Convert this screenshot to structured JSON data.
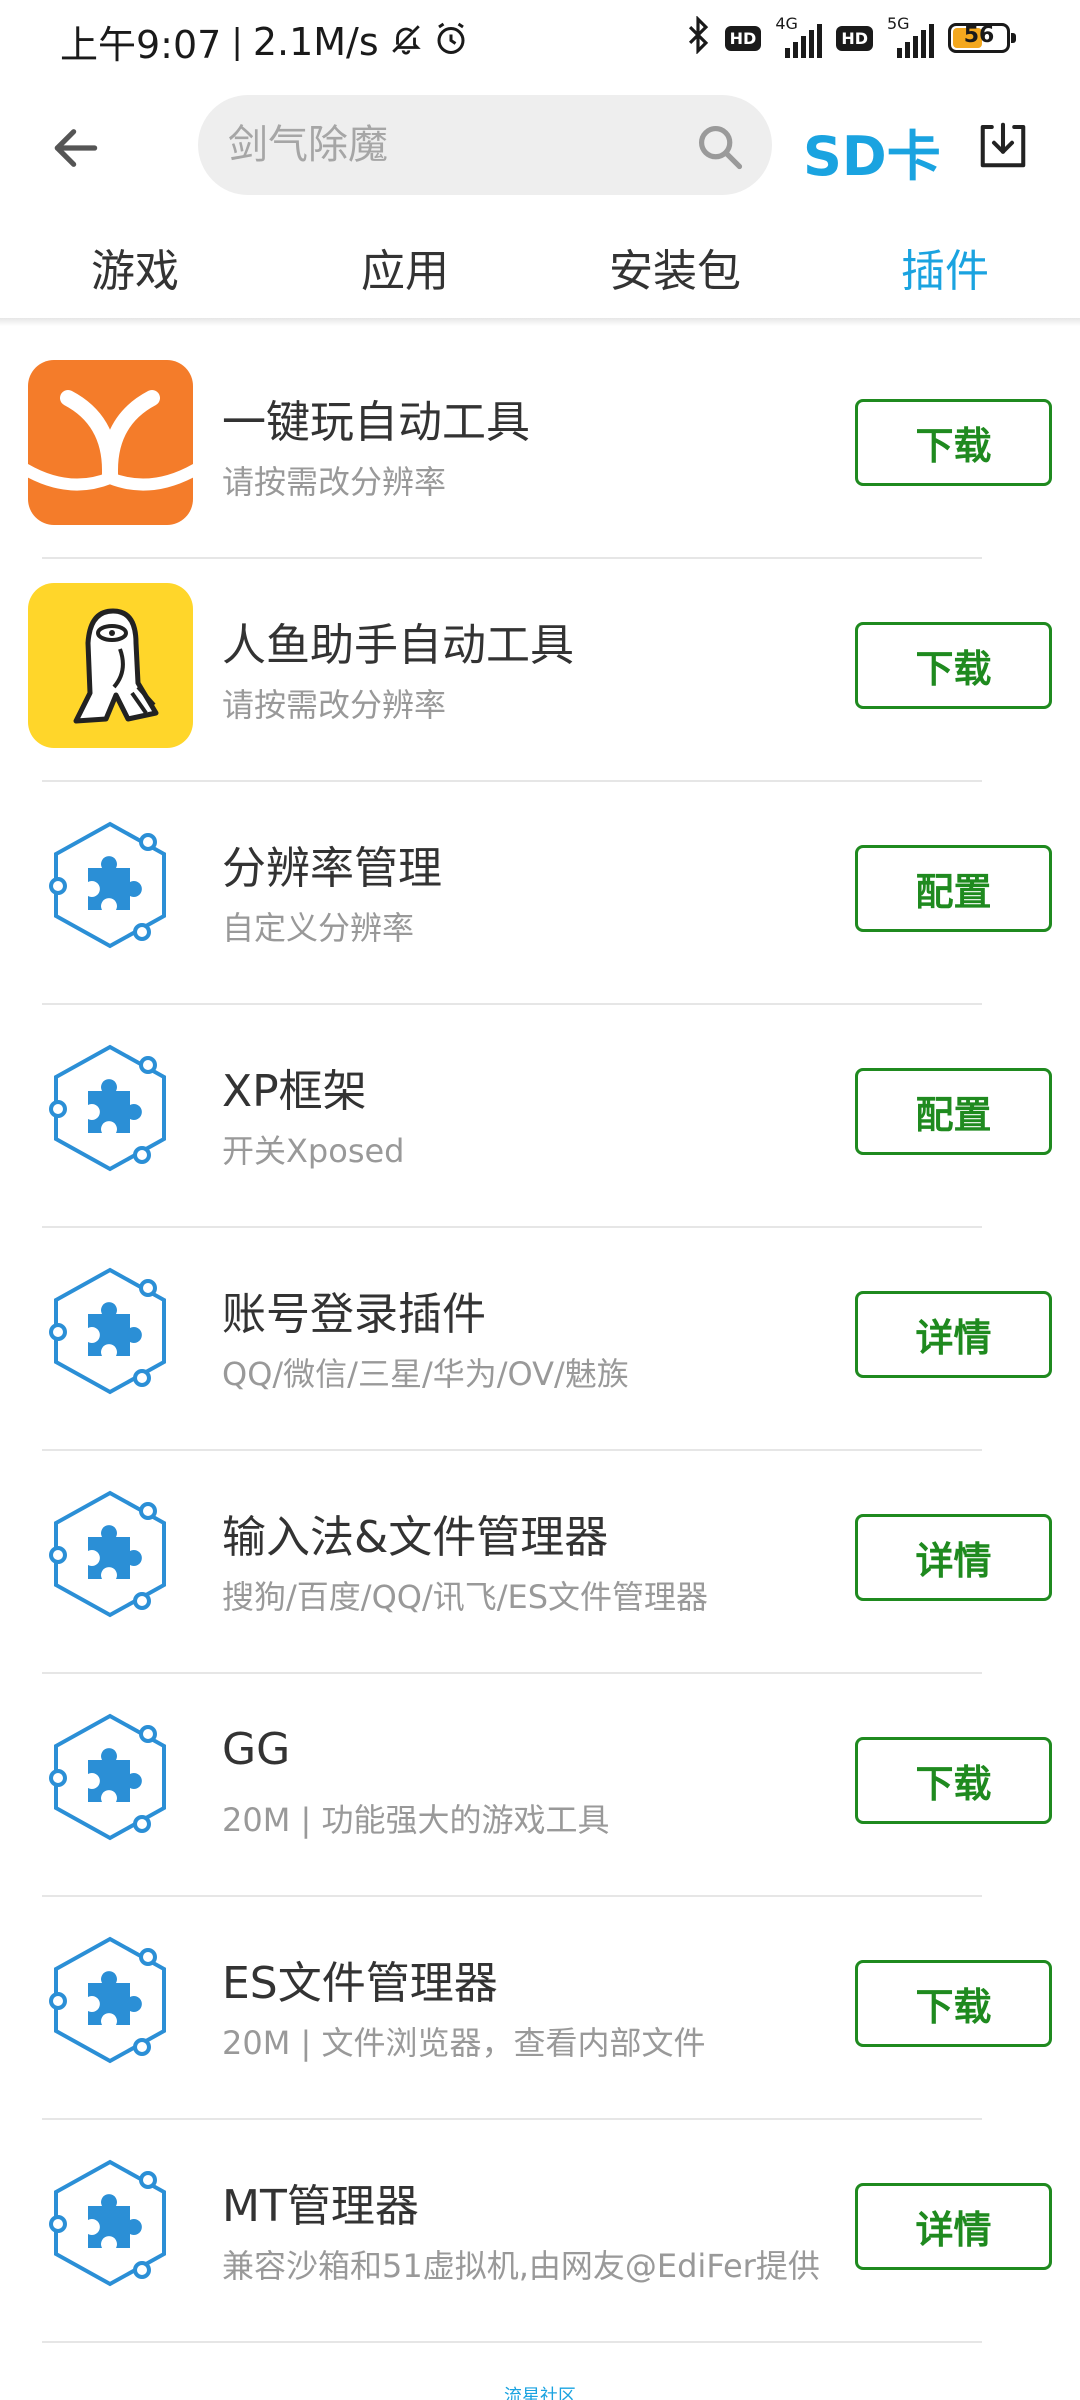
{
  "status_bar": {
    "time": "上午9:07",
    "net_speed": "2.1M/s",
    "mute_icon": "bell-off-icon",
    "alarm_icon": "alarm-icon",
    "bluetooth_icon": "bluetooth-icon",
    "hd_label": "HD",
    "sim1_network": "4G",
    "sim2_network": "5G",
    "battery_level": "56",
    "battery_fraction": 0.56
  },
  "header": {
    "search_placeholder": "剑气除魔",
    "sd_label": "SD卡"
  },
  "tabs": [
    {
      "label": "游戏",
      "active": false
    },
    {
      "label": "应用",
      "active": false
    },
    {
      "label": "安装包",
      "active": false
    },
    {
      "label": "插件",
      "active": true
    }
  ],
  "plugins": [
    {
      "title": "一键玩自动工具",
      "subtitle": "请按需改分辨率",
      "action": "下载",
      "icon": "yijianwan-logo-icon"
    },
    {
      "title": "人鱼助手自动工具",
      "subtitle": "请按需改分辨率",
      "action": "下载",
      "icon": "renyu-mascot-icon"
    },
    {
      "title": "分辨率管理",
      "subtitle": "自定义分辨率",
      "action": "配置",
      "icon": "puzzle-plugin-icon"
    },
    {
      "title": "XP框架",
      "subtitle": "开关Xposed",
      "action": "配置",
      "icon": "puzzle-plugin-icon"
    },
    {
      "title": "账号登录插件",
      "subtitle": "QQ/微信/三星/华为/OV/魅族",
      "action": "详情",
      "icon": "puzzle-plugin-icon"
    },
    {
      "title": "输入法&文件管理器",
      "subtitle": "搜狗/百度/QQ/讯飞/ES文件管理器",
      "action": "详情",
      "icon": "puzzle-plugin-icon"
    },
    {
      "title": "GG",
      "subtitle": "20M | 功能强大的游戏工具",
      "action": "下载",
      "icon": "puzzle-plugin-icon"
    },
    {
      "title": "ES文件管理器",
      "subtitle": "20M | 文件浏览器，查看内部文件",
      "action": "下载",
      "icon": "puzzle-plugin-icon"
    },
    {
      "title": "MT管理器",
      "subtitle": "兼容沙箱和51虚拟机,由网友@EdiFer提供",
      "action": "详情",
      "icon": "puzzle-plugin-icon"
    }
  ],
  "footer": {
    "text": "流星社区"
  },
  "colors": {
    "accent_blue": "#1aa3e0",
    "action_green": "#1f8a1f",
    "yijianwan_orange": "#f47c2a",
    "renyu_yellow": "#ffd62a",
    "plugin_blue": "#2b8fd6"
  }
}
